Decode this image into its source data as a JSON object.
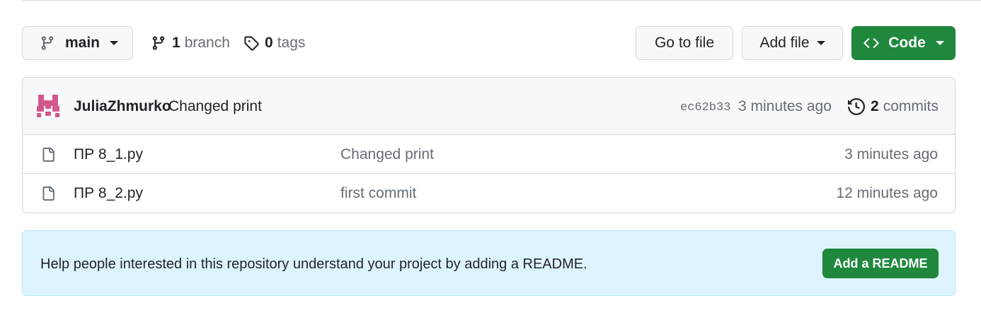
{
  "toolbar": {
    "branch_name": "main",
    "branch_count": "1",
    "branch_label": "branch",
    "tag_count": "0",
    "tag_label": "tags",
    "go_to_file": "Go to file",
    "add_file": "Add file",
    "code": "Code"
  },
  "latest_commit": {
    "author": "JuliaZhmurko",
    "message": "Changed print",
    "sha": "ec62b33",
    "time": "3 minutes ago",
    "commit_count": "2",
    "commit_label": "commits",
    "avatar_color": "#d4578c"
  },
  "files": [
    {
      "name": "ПР 8_1.py",
      "commit_message": "Changed print",
      "time": "3 minutes ago"
    },
    {
      "name": "ПР 8_2.py",
      "commit_message": "first commit",
      "time": "12 minutes ago"
    }
  ],
  "readme_prompt": {
    "text": "Help people interested in this repository understand your project by adding a README.",
    "button": "Add a README"
  },
  "colors": {
    "primary_green": "#1f883d",
    "readme_bg": "#ddf4ff",
    "border": "#d0d7de"
  }
}
